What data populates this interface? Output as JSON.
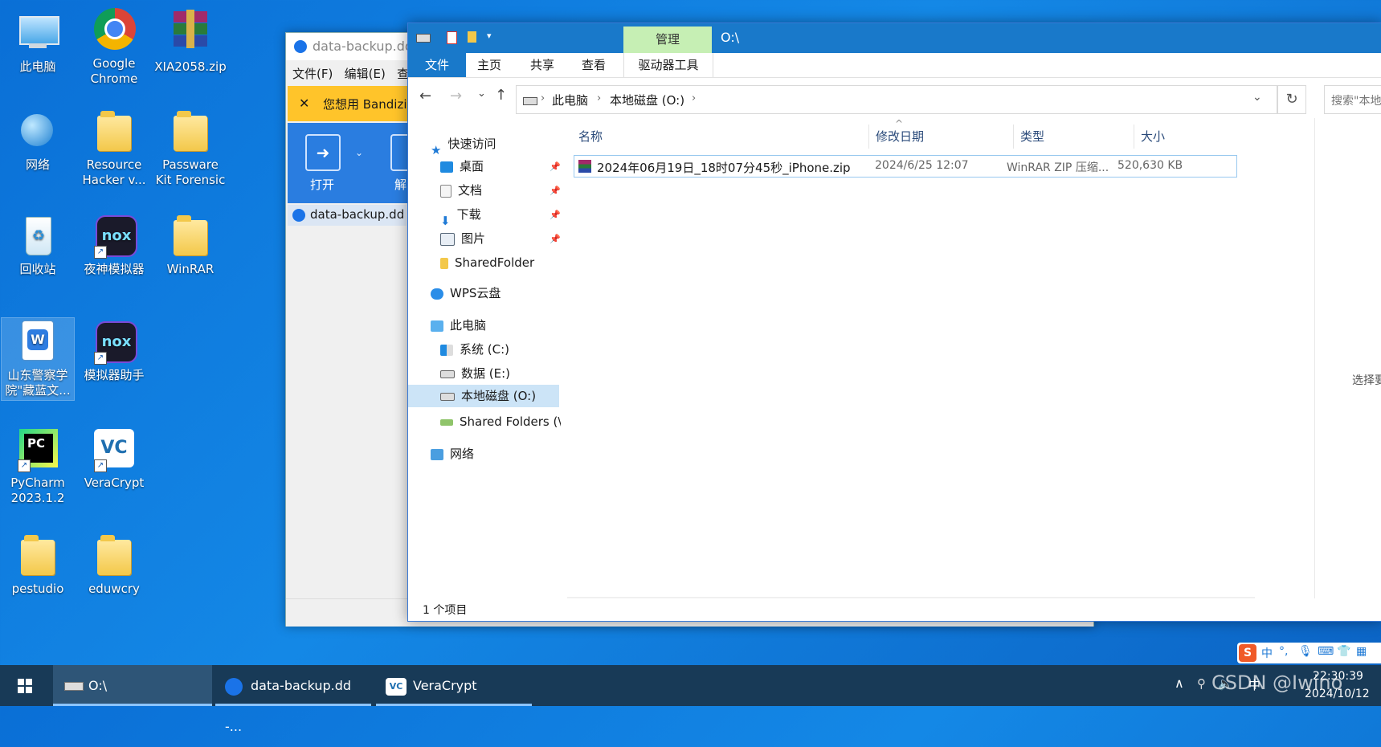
{
  "desktop": {
    "icons": [
      {
        "label": "此电脑"
      },
      {
        "label": "Google Chrome"
      },
      {
        "label": "XIA2058.zip"
      },
      {
        "label": "网络"
      },
      {
        "label": "Resource Hacker v..."
      },
      {
        "label": "Passware Kit Forensic"
      },
      {
        "label": "回收站"
      },
      {
        "label": "夜神模拟器"
      },
      {
        "label": "WinRAR"
      },
      {
        "label": "山东警察学院\"藏蓝文..."
      },
      {
        "label": "模拟器助手"
      },
      {
        "label": "PyCharm 2023.1.2"
      },
      {
        "label": "VeraCrypt"
      },
      {
        "label": "pestudio"
      },
      {
        "label": "eduwcry"
      }
    ]
  },
  "bandizip": {
    "title": "data-backup.dd",
    "menu": [
      "文件(F)",
      "编辑(E)",
      "查"
    ],
    "notice": "您想用 Bandizip",
    "open_label": "打开",
    "extract_label": "解",
    "file_item": "data-backup.dd"
  },
  "explorer": {
    "title": "O:\\",
    "context_tab": "管理",
    "ribbon_tabs": [
      "文件",
      "主页",
      "共享",
      "查看"
    ],
    "context_subtab": "驱动器工具",
    "breadcrumb": [
      "此电脑",
      "本地磁盘 (O:)"
    ],
    "search_placeholder": "搜索\"本地",
    "nav": {
      "quick_access": "快速访问",
      "quick_items": [
        "桌面",
        "文档",
        "下载",
        "图片",
        "SharedFolder"
      ],
      "wps": "WPS云盘",
      "this_pc": "此电脑",
      "drives": [
        "系统 (C:)",
        "数据 (E:)",
        "本地磁盘 (O:)",
        "Shared Folders (\\\\"
      ],
      "network": "网络"
    },
    "columns": [
      "名称",
      "修改日期",
      "类型",
      "大小"
    ],
    "files": [
      {
        "name": "2024年06月19日_18时07分45秒_iPhone.zip",
        "modified": "2024/6/25 12:07",
        "type": "WinRAR ZIP 压缩...",
        "size": "520,630 KB"
      }
    ],
    "status": "1 个项目",
    "preview_hint": "选择要"
  },
  "taskbar": {
    "items": [
      "O:\\",
      "data-backup.dd -...",
      "VeraCrypt"
    ],
    "ime": "中",
    "time": "22:30:39",
    "date": "2024/10/12",
    "watermark": "CSDN @Iwino"
  },
  "colors": {
    "accent": "#1979ca",
    "context_tab": "#c6efb4",
    "taskbar": "#183a57"
  }
}
